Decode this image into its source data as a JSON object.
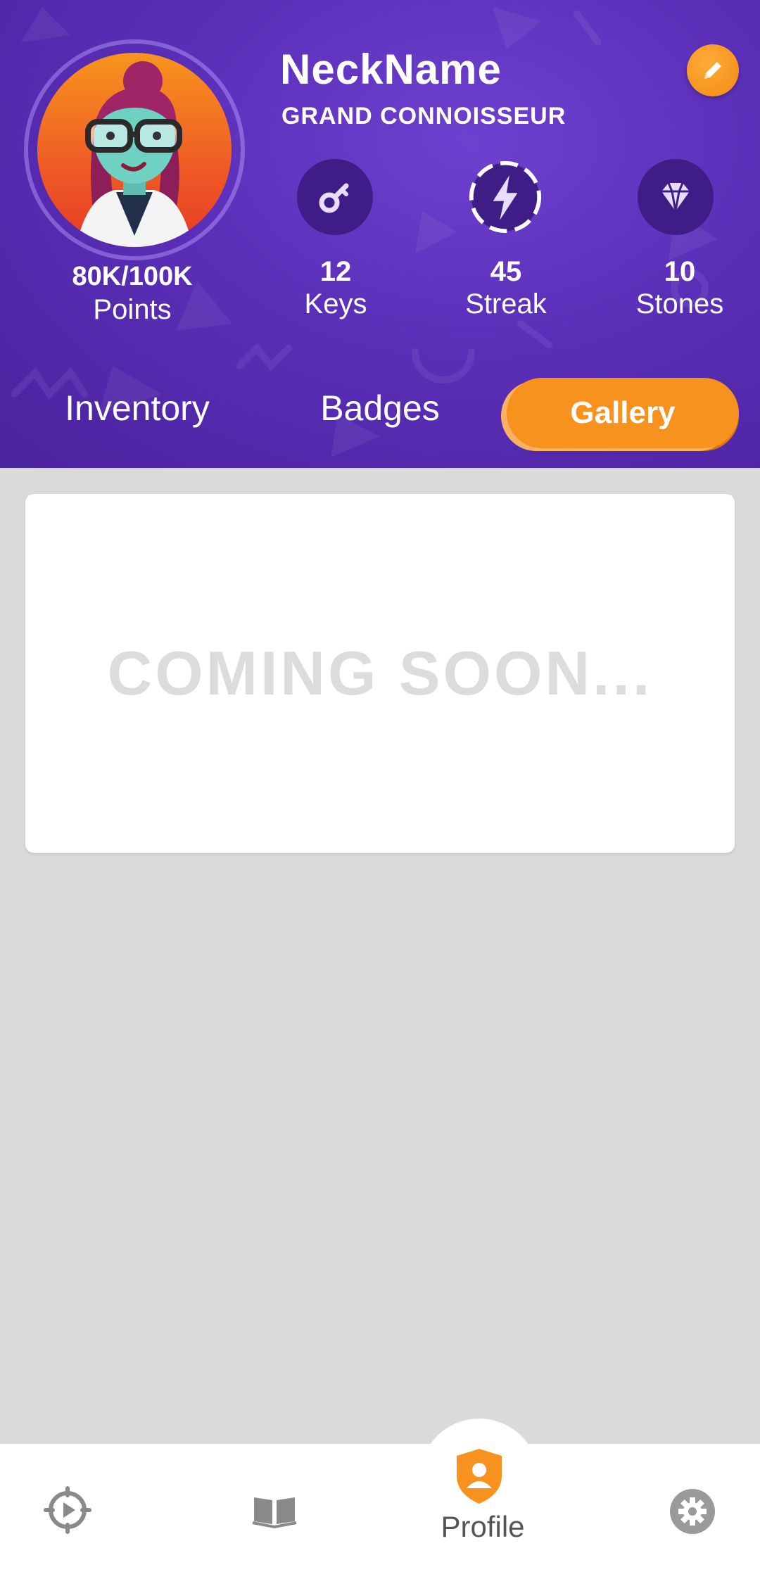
{
  "profile": {
    "username": "NeckName",
    "rank": "GRAND CONNOISSEUR",
    "points_value": "80K/100K",
    "points_label": "Points"
  },
  "stats": [
    {
      "value": "12",
      "label": "Keys",
      "icon": "key-icon"
    },
    {
      "value": "45",
      "label": "Streak",
      "icon": "lightning-icon"
    },
    {
      "value": "10",
      "label": "Stones",
      "icon": "diamond-icon"
    }
  ],
  "tabs": {
    "inventory": "Inventory",
    "badges": "Badges",
    "gallery": "Gallery",
    "active": "gallery"
  },
  "gallery": {
    "message": "COMING SOON..."
  },
  "bottom_nav": {
    "items": [
      {
        "icon": "play-target-icon",
        "label": ""
      },
      {
        "icon": "book-icon",
        "label": ""
      },
      {
        "icon": "profile-shield-icon",
        "label": "Profile",
        "active": true
      },
      {
        "icon": "gear-icon",
        "label": ""
      }
    ]
  },
  "colors": {
    "header_purple": "#5a2fb8",
    "accent_orange": "#f7921e",
    "stat_icon_bg": "#3e1e86",
    "page_bg": "#dadada"
  }
}
